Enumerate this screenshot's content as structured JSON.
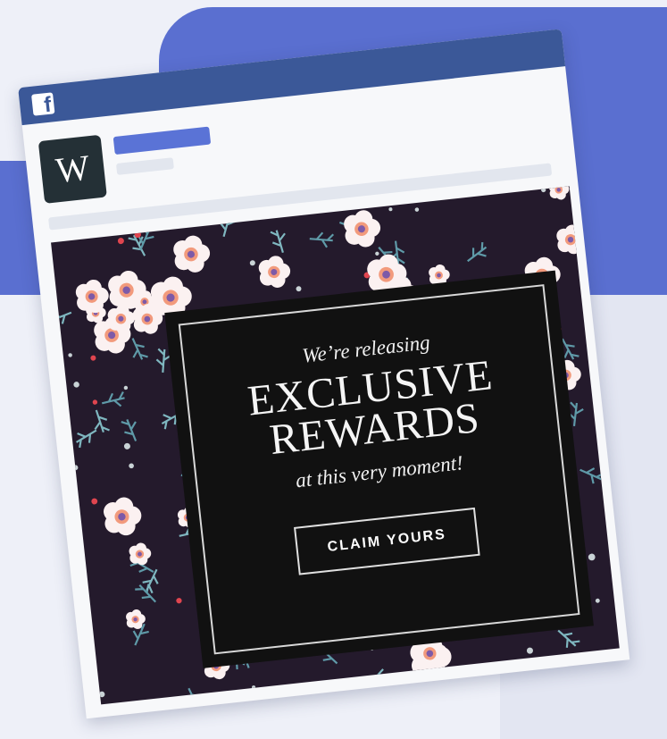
{
  "brand": {
    "network_logo_glyph": "f",
    "network_icon": "facebook-icon",
    "avatar_letter": "W"
  },
  "colors": {
    "background": "#eef0f8",
    "accent_blue": "#5a6fd0",
    "titlebar": "#3b5898",
    "name_bar": "#5a73d6",
    "ad_background": "#241a2c",
    "promo_box": "#111111"
  },
  "ad": {
    "line1": "We’re releasing",
    "headline_line1": "EXCLUSIVE",
    "headline_line2": "REWARDS",
    "line3": "at this very moment!",
    "cta_label": "CLAIM YOURS"
  }
}
